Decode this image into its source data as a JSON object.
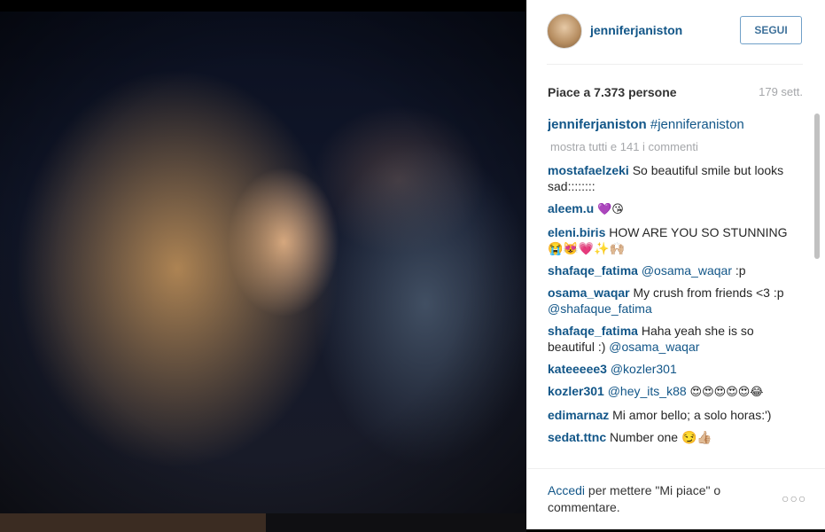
{
  "post": {
    "username": "jenniferjaniston",
    "follow_label": "SEGUI",
    "likes_text": "Piace a 7.373 persone",
    "time_text": "179 sett."
  },
  "caption": {
    "user": "jenniferjaniston",
    "text": "#jenniferaniston"
  },
  "show_all_text": "mostra tutti e 141 i commenti",
  "comments": [
    {
      "user": "mostafaelzeki",
      "text": "So beautiful smile but looks sad::::::::"
    },
    {
      "user": "aleem.u",
      "text": "💜😘"
    },
    {
      "user": "eleni.biris",
      "text": "HOW ARE YOU SO STUNNING 😭😻💗✨🙌🏼"
    },
    {
      "user": "shafaqe_fatima",
      "mention": "@osama_waqar",
      "text": ":p"
    },
    {
      "user": "osama_waqar",
      "text": "My crush from friends <3 :p",
      "mention": "@shafaque_fatima"
    },
    {
      "user": "shafaqe_fatima",
      "text": "Haha yeah she is so beautiful :)",
      "mention": "@osama_waqar"
    },
    {
      "user": "kateeeee3",
      "mention": "@kozler301"
    },
    {
      "user": "kozler301",
      "mention": "@hey_its_k88",
      "text": "😍😍😍😍😍😂"
    },
    {
      "user": "edimarnaz",
      "text": "Mi amor bello; a solo horas:')"
    },
    {
      "user": "sedat.ttnc",
      "text": "Number one 😏👍🏼"
    }
  ],
  "footer": {
    "login_link": "Accedi",
    "login_text": "per mettere \"Mi piace\" o commentare."
  },
  "icons": {
    "more": "more-options-icon"
  }
}
